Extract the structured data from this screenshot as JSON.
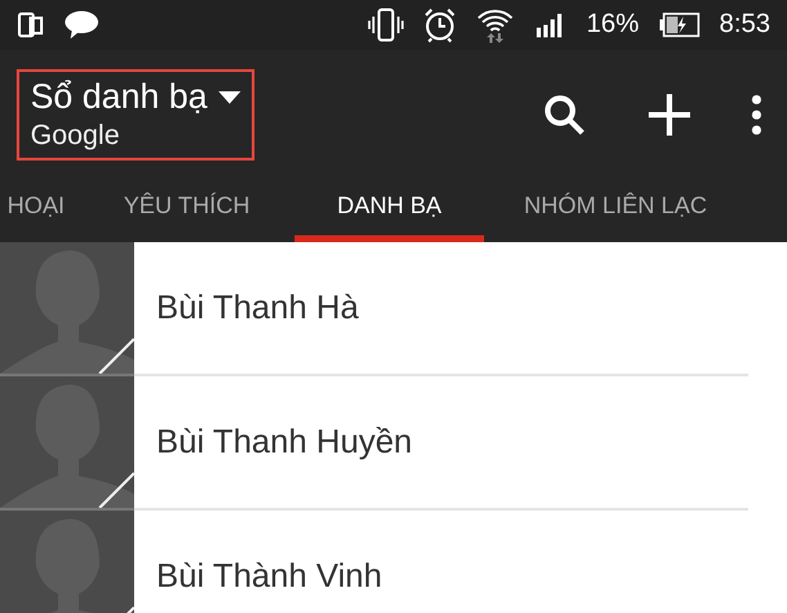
{
  "status_bar": {
    "battery": "16%",
    "time": "8:53"
  },
  "header": {
    "title": "Sổ danh bạ",
    "subtitle": "Google",
    "highlighted": true
  },
  "tabs": [
    {
      "label": "HOẠI",
      "selected": false
    },
    {
      "label": "YÊU THÍCH",
      "selected": false
    },
    {
      "label": "DANH BẠ",
      "selected": true
    },
    {
      "label": "NHÓM LIÊN LẠC",
      "selected": false
    }
  ],
  "contacts": [
    {
      "name": "Bùi Thanh Hà"
    },
    {
      "name": "Bùi Thanh Huyền"
    },
    {
      "name": "Bùi Thành Vinh"
    }
  ]
}
